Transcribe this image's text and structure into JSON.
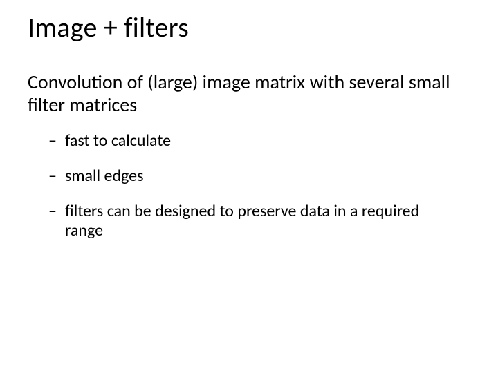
{
  "slide": {
    "title": "Image + filters",
    "body": "Convolution of (large) image matrix with several small filter matrices",
    "bullets": [
      "fast to calculate",
      "small edges",
      "filters can be designed to preserve data in a required range"
    ]
  }
}
